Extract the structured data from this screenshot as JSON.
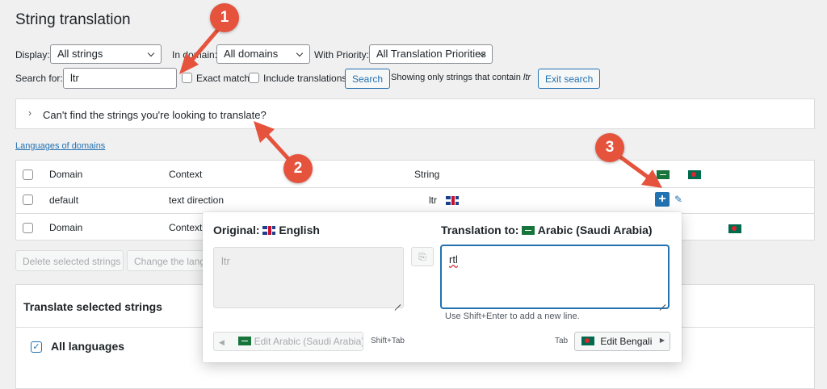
{
  "page": {
    "title": "String translation"
  },
  "filters": {
    "display_label": "Display:",
    "display_value": "All strings",
    "domain_label": "In domain:",
    "domain_value": "All domains",
    "priority_label": "With Priority:",
    "priority_value": "All Translation Priorities",
    "search_label": "Search for:",
    "search_value": "ltr",
    "exact_match": "Exact match",
    "include_translations": "Include translations",
    "search_button": "Search",
    "showing_prefix": "Showing only strings that contain ",
    "showing_term": "ltr",
    "exit_search": "Exit search"
  },
  "help_box": {
    "text": "Can't find the strings you're looking to translate?"
  },
  "languages_link": "Languages of domains",
  "table": {
    "headers": {
      "domain": "Domain",
      "context": "Context",
      "string": "String"
    },
    "rows": [
      {
        "domain": "default",
        "context": "text direction",
        "string": "ltr"
      }
    ],
    "footer": {
      "domain": "Domain",
      "context": "Context"
    }
  },
  "bulk": {
    "delete_button": "Delete selected strings",
    "change_button": "Change the language of selected strings"
  },
  "translate_box": {
    "title": "Translate selected strings",
    "all_languages": "All languages"
  },
  "popup": {
    "original_label": "Original:",
    "original_language": "English",
    "original_text": "ltr",
    "translation_label": "Translation to:",
    "translation_language": "Arabic (Saudi Arabia)",
    "translation_text": "rtl",
    "hint": "Use Shift+Enter to add a new line.",
    "prev_button": "Edit Arabic (Saudi Arabia)",
    "prev_shortcut": "Shift+Tab",
    "next_shortcut": "Tab",
    "next_button": "Edit Bengali"
  },
  "callouts": {
    "one": "1",
    "two": "2",
    "three": "3"
  },
  "colors": {
    "accent": "#2271b1",
    "callout": "#e5533d",
    "plus_button": "#2271b1"
  }
}
